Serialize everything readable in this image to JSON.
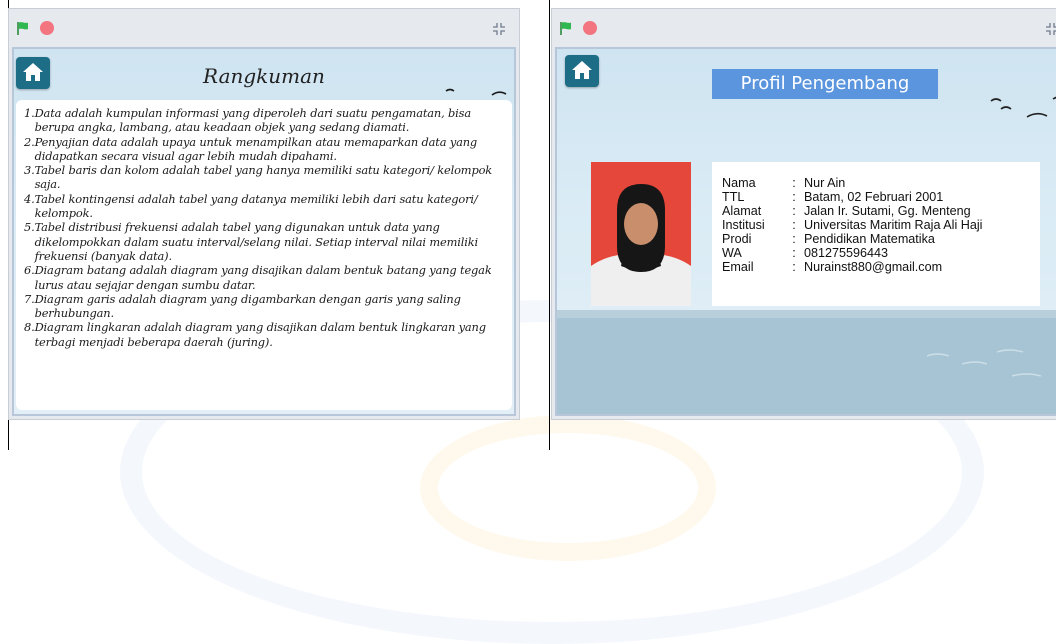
{
  "left_window": {
    "slide_title": "Rangkuman",
    "items": [
      {
        "num": "1.",
        "text": "Data adalah kumpulan informasi yang diperoleh dari suatu pengamatan, bisa berupa angka, lambang, atau keadaan objek yang sedang diamati."
      },
      {
        "num": "2.",
        "text": "Penyajian data adalah upaya untuk menampilkan atau memaparkan data yang didapatkan secara visual agar lebih mudah dipahami."
      },
      {
        "num": "3.",
        "text": "Tabel baris dan kolom adalah tabel yang hanya memiliki satu kategori/ kelompok saja."
      },
      {
        "num": "4.",
        "text": "Tabel kontingensi adalah tabel yang datanya memiliki lebih dari satu kategori/ kelompok."
      },
      {
        "num": "5.",
        "text": "Tabel distribusi frekuensi adalah tabel yang digunakan untuk data yang dikelompokkan dalam suatu interval/selang nilai. Setiap interval nilai memiliki frekuensi (banyak data)."
      },
      {
        "num": "6.",
        "text": "Diagram batang adalah diagram yang disajikan dalam bentuk batang yang tegak lurus atau sejajar dengan sumbu datar."
      },
      {
        "num": "7.",
        "text": "Diagram garis adalah diagram yang digambarkan dengan garis yang saling berhubungan."
      },
      {
        "num": "8.",
        "text": "Diagram lingkaran adalah diagram yang disajikan dalam bentuk lingkaran yang terbagi menjadi beberapa daerah (juring)."
      }
    ]
  },
  "right_window": {
    "slide_title": "Profil Pengembang",
    "profile": [
      {
        "label": "Nama",
        "sep": ":",
        "value": "Nur Ain"
      },
      {
        "label": "TTL",
        "sep": ":",
        "value": "Batam, 02 Februari 2001"
      },
      {
        "label": "Alamat",
        "sep": ":",
        "value": "Jalan Ir. Sutami, Gg. Menteng"
      },
      {
        "label": "Institusi",
        "sep": ":",
        "value": "Universitas Maritim Raja Ali Haji"
      },
      {
        "label": "Prodi",
        "sep": ":",
        "value": "Pendidikan Matematika"
      },
      {
        "label": "WA",
        "sep": ":",
        "value": "081275596443"
      },
      {
        "label": "Email",
        "sep": ":",
        "value": "Nurainst880@gmail.com"
      }
    ]
  },
  "colors": {
    "flag_green": "#2fb84f",
    "stop_red": "#f2757f",
    "home_button": "#1e6d86",
    "title_banner": "#5b95de",
    "photo_background": "#e5473a"
  },
  "icons": {
    "green_flag": "green-flag-icon",
    "stop": "stop-icon",
    "fullscreen": "fullscreen-icon",
    "home": "home-icon"
  }
}
